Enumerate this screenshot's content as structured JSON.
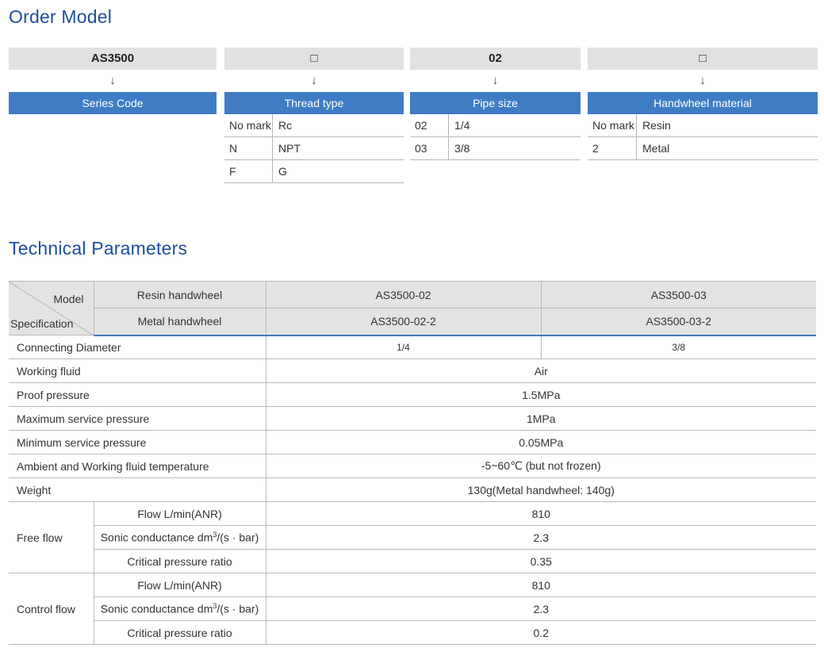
{
  "order_model": {
    "title": "Order Model",
    "arrow": "↓",
    "columns": [
      {
        "code": "AS3500",
        "heading": "Series Code",
        "rows": []
      },
      {
        "code": "□",
        "heading": "Thread type",
        "rows": [
          {
            "key": "No mark",
            "value": "Rc"
          },
          {
            "key": "N",
            "value": "NPT"
          },
          {
            "key": "F",
            "value": "G"
          }
        ]
      },
      {
        "code": "02",
        "heading": "Pipe size",
        "rows": [
          {
            "key": "02",
            "value": "1/4"
          },
          {
            "key": "03",
            "value": "3/8"
          }
        ]
      },
      {
        "code": "□",
        "heading": "Handwheel material",
        "rows": [
          {
            "key": "No mark",
            "value": "Resin"
          },
          {
            "key": "2",
            "value": "Metal"
          }
        ]
      }
    ]
  },
  "tech": {
    "title": "Technical Parameters",
    "corner_model": "Model",
    "corner_spec": "Specification",
    "resin_label": "Resin handwheel",
    "metal_label": "Metal handwheel",
    "models_resin": [
      "AS3500-02",
      "AS3500-03"
    ],
    "models_metal": [
      "AS3500-02-2",
      "AS3500-03-2"
    ],
    "connecting": {
      "label": "Connecting Diameter",
      "values": [
        "1/4",
        "3/8"
      ]
    },
    "rows": [
      {
        "label": "Working fluid",
        "value": "Air"
      },
      {
        "label": "Proof pressure",
        "value": "1.5MPa"
      },
      {
        "label": "Maximum service pressure",
        "value": "1MPa"
      },
      {
        "label": "Minimum service pressure",
        "value": "0.05MPa"
      },
      {
        "label": "Ambient and Working fluid  temperature",
        "value": "-5~60℃ (but not frozen)"
      },
      {
        "label": "Weight",
        "value": "130g(Metal handwheel: 140g)"
      }
    ],
    "free_flow": {
      "label": "Free flow",
      "flow_label": "Flow  L/min(ANR)",
      "flow": "810",
      "sonic_label_a": "Sonic conductance  dm",
      "sonic_sup": "3",
      "sonic_label_b": "/(s · bar)",
      "sonic": "2.3",
      "crit_label": "Critical pressure ratio",
      "crit": "0.35"
    },
    "control_flow": {
      "label": "Control flow",
      "flow_label": "Flow  L/min(ANR)",
      "flow": "810",
      "sonic_label_a": "Sonic conductance  dm",
      "sonic_sup": "3",
      "sonic_label_b": "/(s · bar)",
      "sonic": "2.3",
      "crit_label": "Critical pressure ratio",
      "crit": "0.2"
    }
  }
}
